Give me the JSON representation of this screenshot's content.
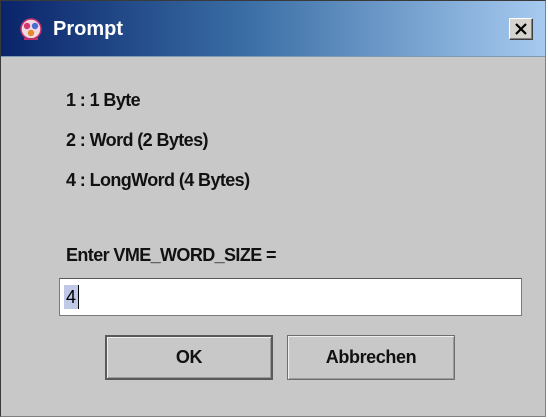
{
  "window": {
    "title": "Prompt",
    "icon": "app-icon",
    "close_icon": "close-icon"
  },
  "message": {
    "line1": "1 : 1 Byte",
    "line2": "2 : Word (2 Bytes)",
    "line3": "4 : LongWord (4 Bytes)",
    "prompt": "Enter VME_WORD_SIZE ="
  },
  "input": {
    "value": "4"
  },
  "buttons": {
    "ok_label": "OK",
    "cancel_label": "Abbrechen"
  },
  "colors": {
    "titlebar_dark": "#0a246a",
    "titlebar_light": "#a6caf0",
    "dialog_bg": "#c8c8c8",
    "selection": "#c0c8e8"
  }
}
